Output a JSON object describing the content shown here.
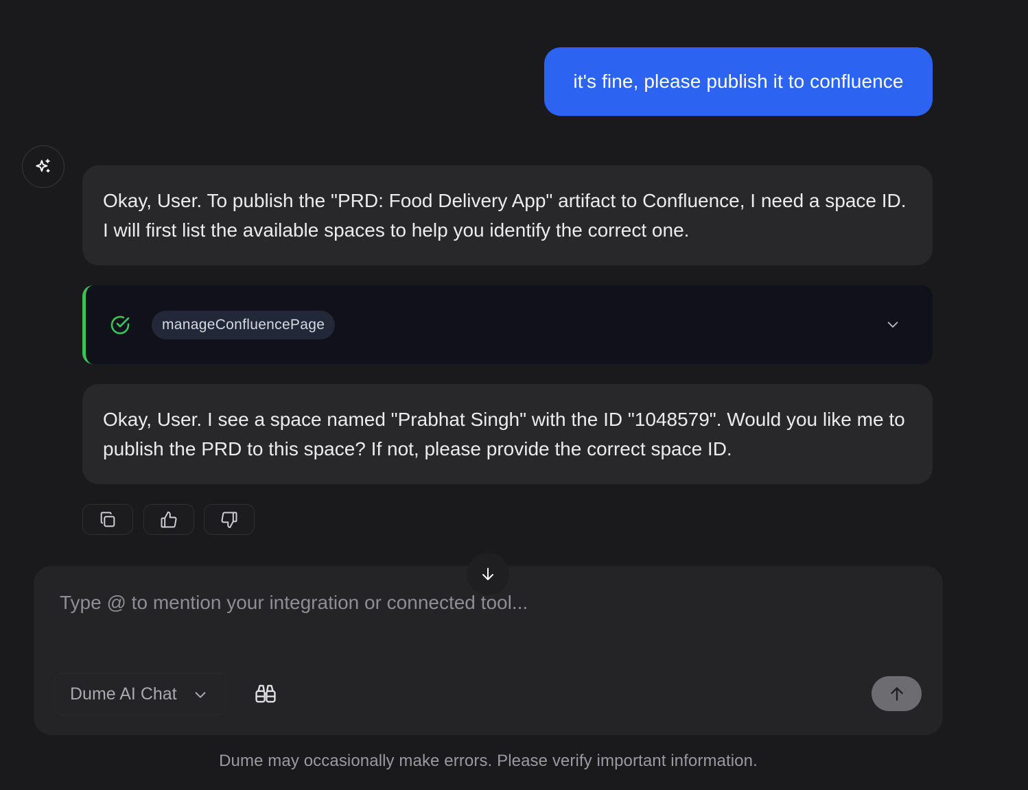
{
  "conversation": {
    "user_message": "it's fine, please publish it to confluence",
    "assistant_message_1": "Okay, User. To publish the \"PRD: Food Delivery App\" artifact to Confluence, I need a space ID. I will first list the available spaces to help you identify the correct one.",
    "tool_call": {
      "name": "manageConfluencePage",
      "status": "completed",
      "status_color": "#3fbf5a"
    },
    "assistant_message_2": "Okay, User. I see a space named \"Prabhat Singh\" with the ID \"1048579\". Would you like me to publish the PRD to this space? If not, please provide the correct space ID."
  },
  "message_actions": {
    "icons": [
      "copy-icon",
      "thumbs-up-icon",
      "thumbs-down-icon"
    ]
  },
  "composer": {
    "placeholder": "Type @ to mention your integration or connected tool...",
    "value": "",
    "model_label": "Dume AI Chat"
  },
  "footer": {
    "disclaimer": "Dume may occasionally make errors. Please verify important information."
  },
  "colors": {
    "background": "#1a1a1c",
    "user_bubble": "#2c63f0",
    "assistant_bubble": "#28282b",
    "tool_card": "#10111a",
    "accent_success": "#3fbf5a",
    "send_button": "#6d6d71"
  }
}
